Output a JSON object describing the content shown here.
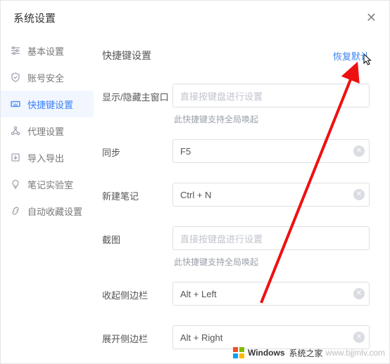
{
  "window": {
    "title": "系统设置"
  },
  "sidebar": {
    "items": [
      {
        "label": "基本设置"
      },
      {
        "label": "账号安全"
      },
      {
        "label": "快捷键设置"
      },
      {
        "label": "代理设置"
      },
      {
        "label": "导入导出"
      },
      {
        "label": "笔记实验室"
      },
      {
        "label": "自动收藏设置"
      }
    ]
  },
  "main": {
    "section_title": "快捷键设置",
    "restore_default": "恢复默认",
    "placeholder": "直接按键盘进行设置",
    "global_hint": "此快捷键支持全局唤起",
    "rows": {
      "show_hide": {
        "label": "显示/隐藏主窗口"
      },
      "sync": {
        "label": "同步",
        "value": "F5"
      },
      "new_note": {
        "label": "新建笔记",
        "value": "Ctrl + N"
      },
      "screenshot": {
        "label": "截图"
      },
      "coll_sidebar": {
        "label": "收起侧边栏",
        "value": "Alt + Left"
      },
      "exp_sidebar": {
        "label": "展开侧边栏",
        "value": "Alt + Right"
      }
    }
  },
  "watermark": {
    "brand": "Windows",
    "sub": "系统之家",
    "url": "www.bjjmlv.com"
  }
}
